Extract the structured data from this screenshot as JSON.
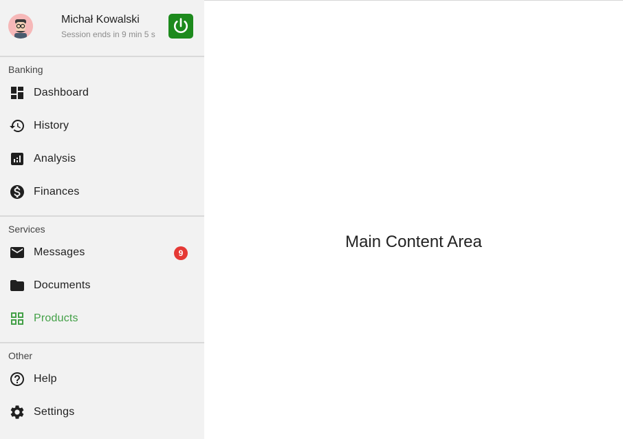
{
  "user": {
    "name": "Michał Kowalski",
    "session": "Session ends in 9 min 5 s"
  },
  "colors": {
    "sidebar_bg": "#f2f2f2",
    "active": "#43a047",
    "power_button": "#1d8a1d",
    "badge": "#e53935"
  },
  "sections": [
    {
      "title": "Banking",
      "items": [
        {
          "label": "Dashboard",
          "icon": "dashboard-icon"
        },
        {
          "label": "History",
          "icon": "history-icon"
        },
        {
          "label": "Analysis",
          "icon": "analytics-icon"
        },
        {
          "label": "Finances",
          "icon": "dollar-circle-icon"
        }
      ]
    },
    {
      "title": "Services",
      "items": [
        {
          "label": "Messages",
          "icon": "mail-icon",
          "badge": "9"
        },
        {
          "label": "Documents",
          "icon": "folder-icon"
        },
        {
          "label": "Products",
          "icon": "grid-icon",
          "active": true
        }
      ]
    },
    {
      "title": "Other",
      "items": [
        {
          "label": "Help",
          "icon": "help-circle-icon"
        },
        {
          "label": "Settings",
          "icon": "gear-icon"
        }
      ]
    }
  ],
  "main": {
    "title": "Main Content Area"
  }
}
